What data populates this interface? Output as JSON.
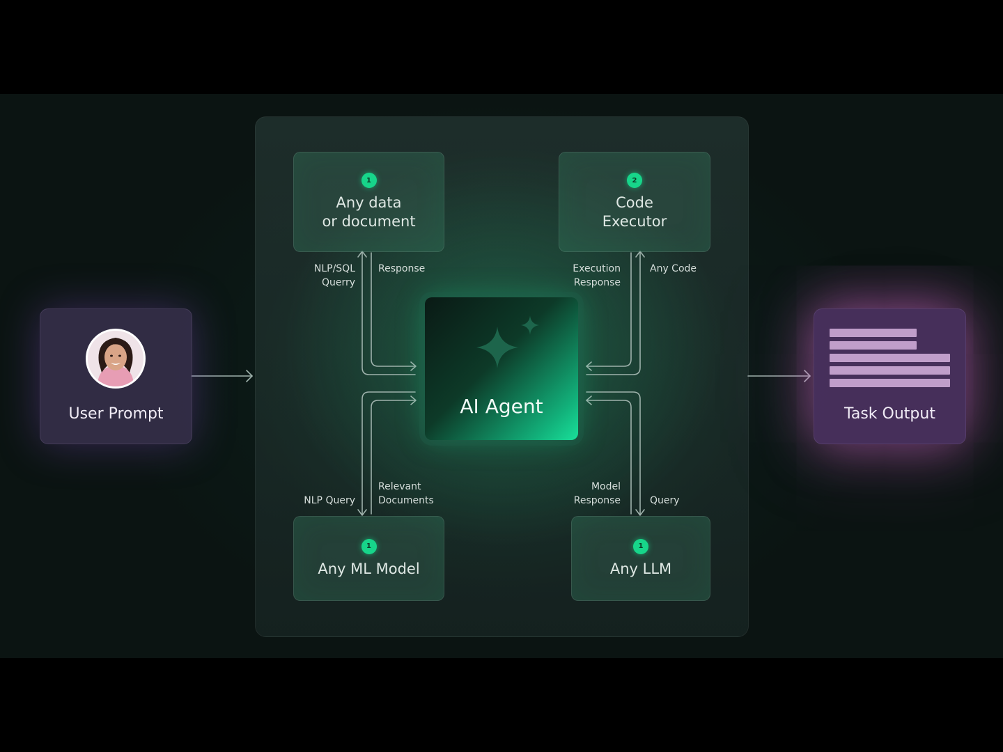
{
  "user_prompt": {
    "title": "User Prompt"
  },
  "task_output": {
    "title": "Task Output"
  },
  "agent": {
    "title": "AI Agent"
  },
  "nodes": {
    "data": {
      "badge": "1",
      "title_line1": "Any data",
      "title_line2": "or document"
    },
    "code": {
      "badge": "2",
      "title_line1": "Code",
      "title_line2": "Executor"
    },
    "ml": {
      "badge": "1",
      "title": "Any ML Model"
    },
    "llm": {
      "badge": "1",
      "title": "Any LLM"
    }
  },
  "labels": {
    "nlp_sql": "NLP/SQL\nQuerry",
    "response": "Response",
    "execution_response": "Execution\nResponse",
    "any_code": "Any Code",
    "nlp_query": "NLP Query",
    "relevant_documents": "Relevant\nDocuments",
    "model_response": "Model\nResponse",
    "query": "Query"
  },
  "icons": {
    "agent": "sparkle-icon",
    "user": "avatar-photo",
    "output": "document-lines-icon"
  },
  "colors": {
    "accent_green": "#17d58a",
    "output_glow": "#dc6ed2",
    "user_glow": "#8c50d2"
  }
}
